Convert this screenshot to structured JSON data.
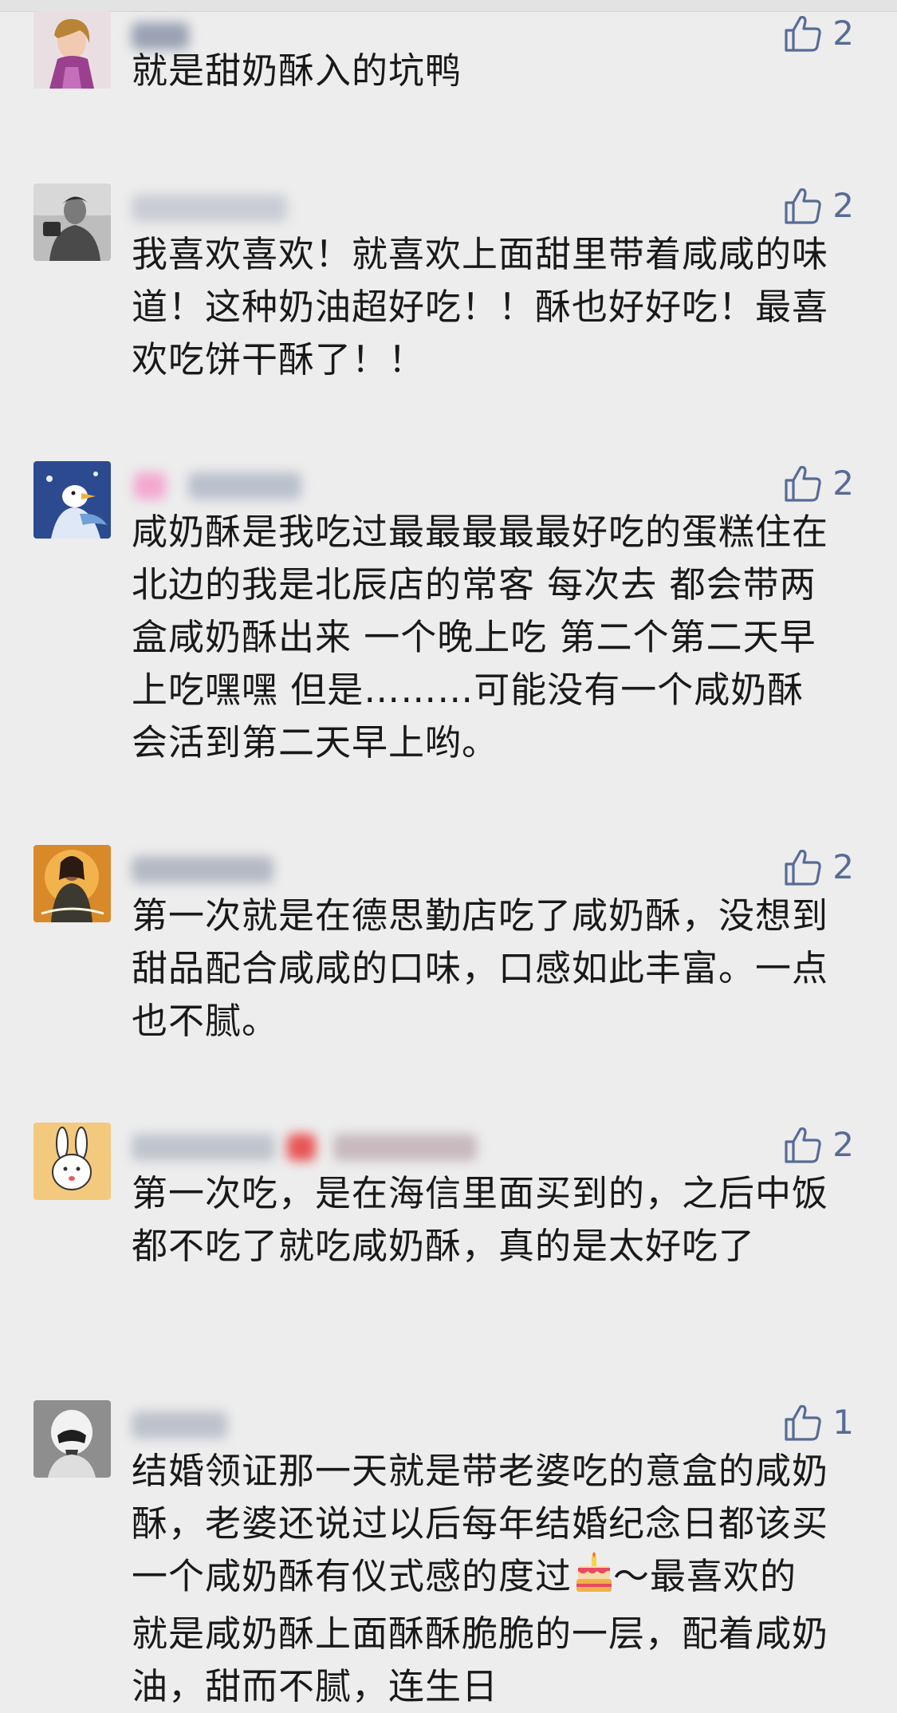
{
  "comments": [
    {
      "likes": "2",
      "text": "就是甜奶酥入的坑鸭"
    },
    {
      "likes": "2",
      "text": "我喜欢喜欢！就喜欢上面甜里带着咸咸的味道！这种奶油超好吃！！酥也好好吃！最喜欢吃饼干酥了！！"
    },
    {
      "likes": "2",
      "text": "咸奶酥是我吃过最最最最最好吃的蛋糕住在北边的我是北辰店的常客 每次去 都会带两盒咸奶酥出来 一个晚上吃 第二个第二天早上吃嘿嘿 但是………可能没有一个咸奶酥会活到第二天早上哟。"
    },
    {
      "likes": "2",
      "text": "第一次就是在德思勤店吃了咸奶酥，没想到甜品配合咸咸的口味，口感如此丰富。一点也不腻。"
    },
    {
      "likes": "2",
      "text": "第一次吃，是在海信里面买到的，之后中饭都不吃了就吃咸奶酥，真的是太好吃了"
    },
    {
      "likes": "1",
      "text": "结婚领证那一天就是带老婆吃的意盒的咸奶酥，老婆还说过以后每年结婚纪念日都该买一个咸奶酥有仪式感的度过",
      "text2": "～最喜欢的就是咸奶酥上面酥酥脆脆的一层，配着咸奶油，甜而不腻，连生日"
    }
  ],
  "colors": {
    "background": "#ededed",
    "like_blue": "#576b95",
    "text": "#191919"
  },
  "icons": {
    "like": "thumbs-up-icon",
    "cake": "birthday-cake-emoji"
  }
}
